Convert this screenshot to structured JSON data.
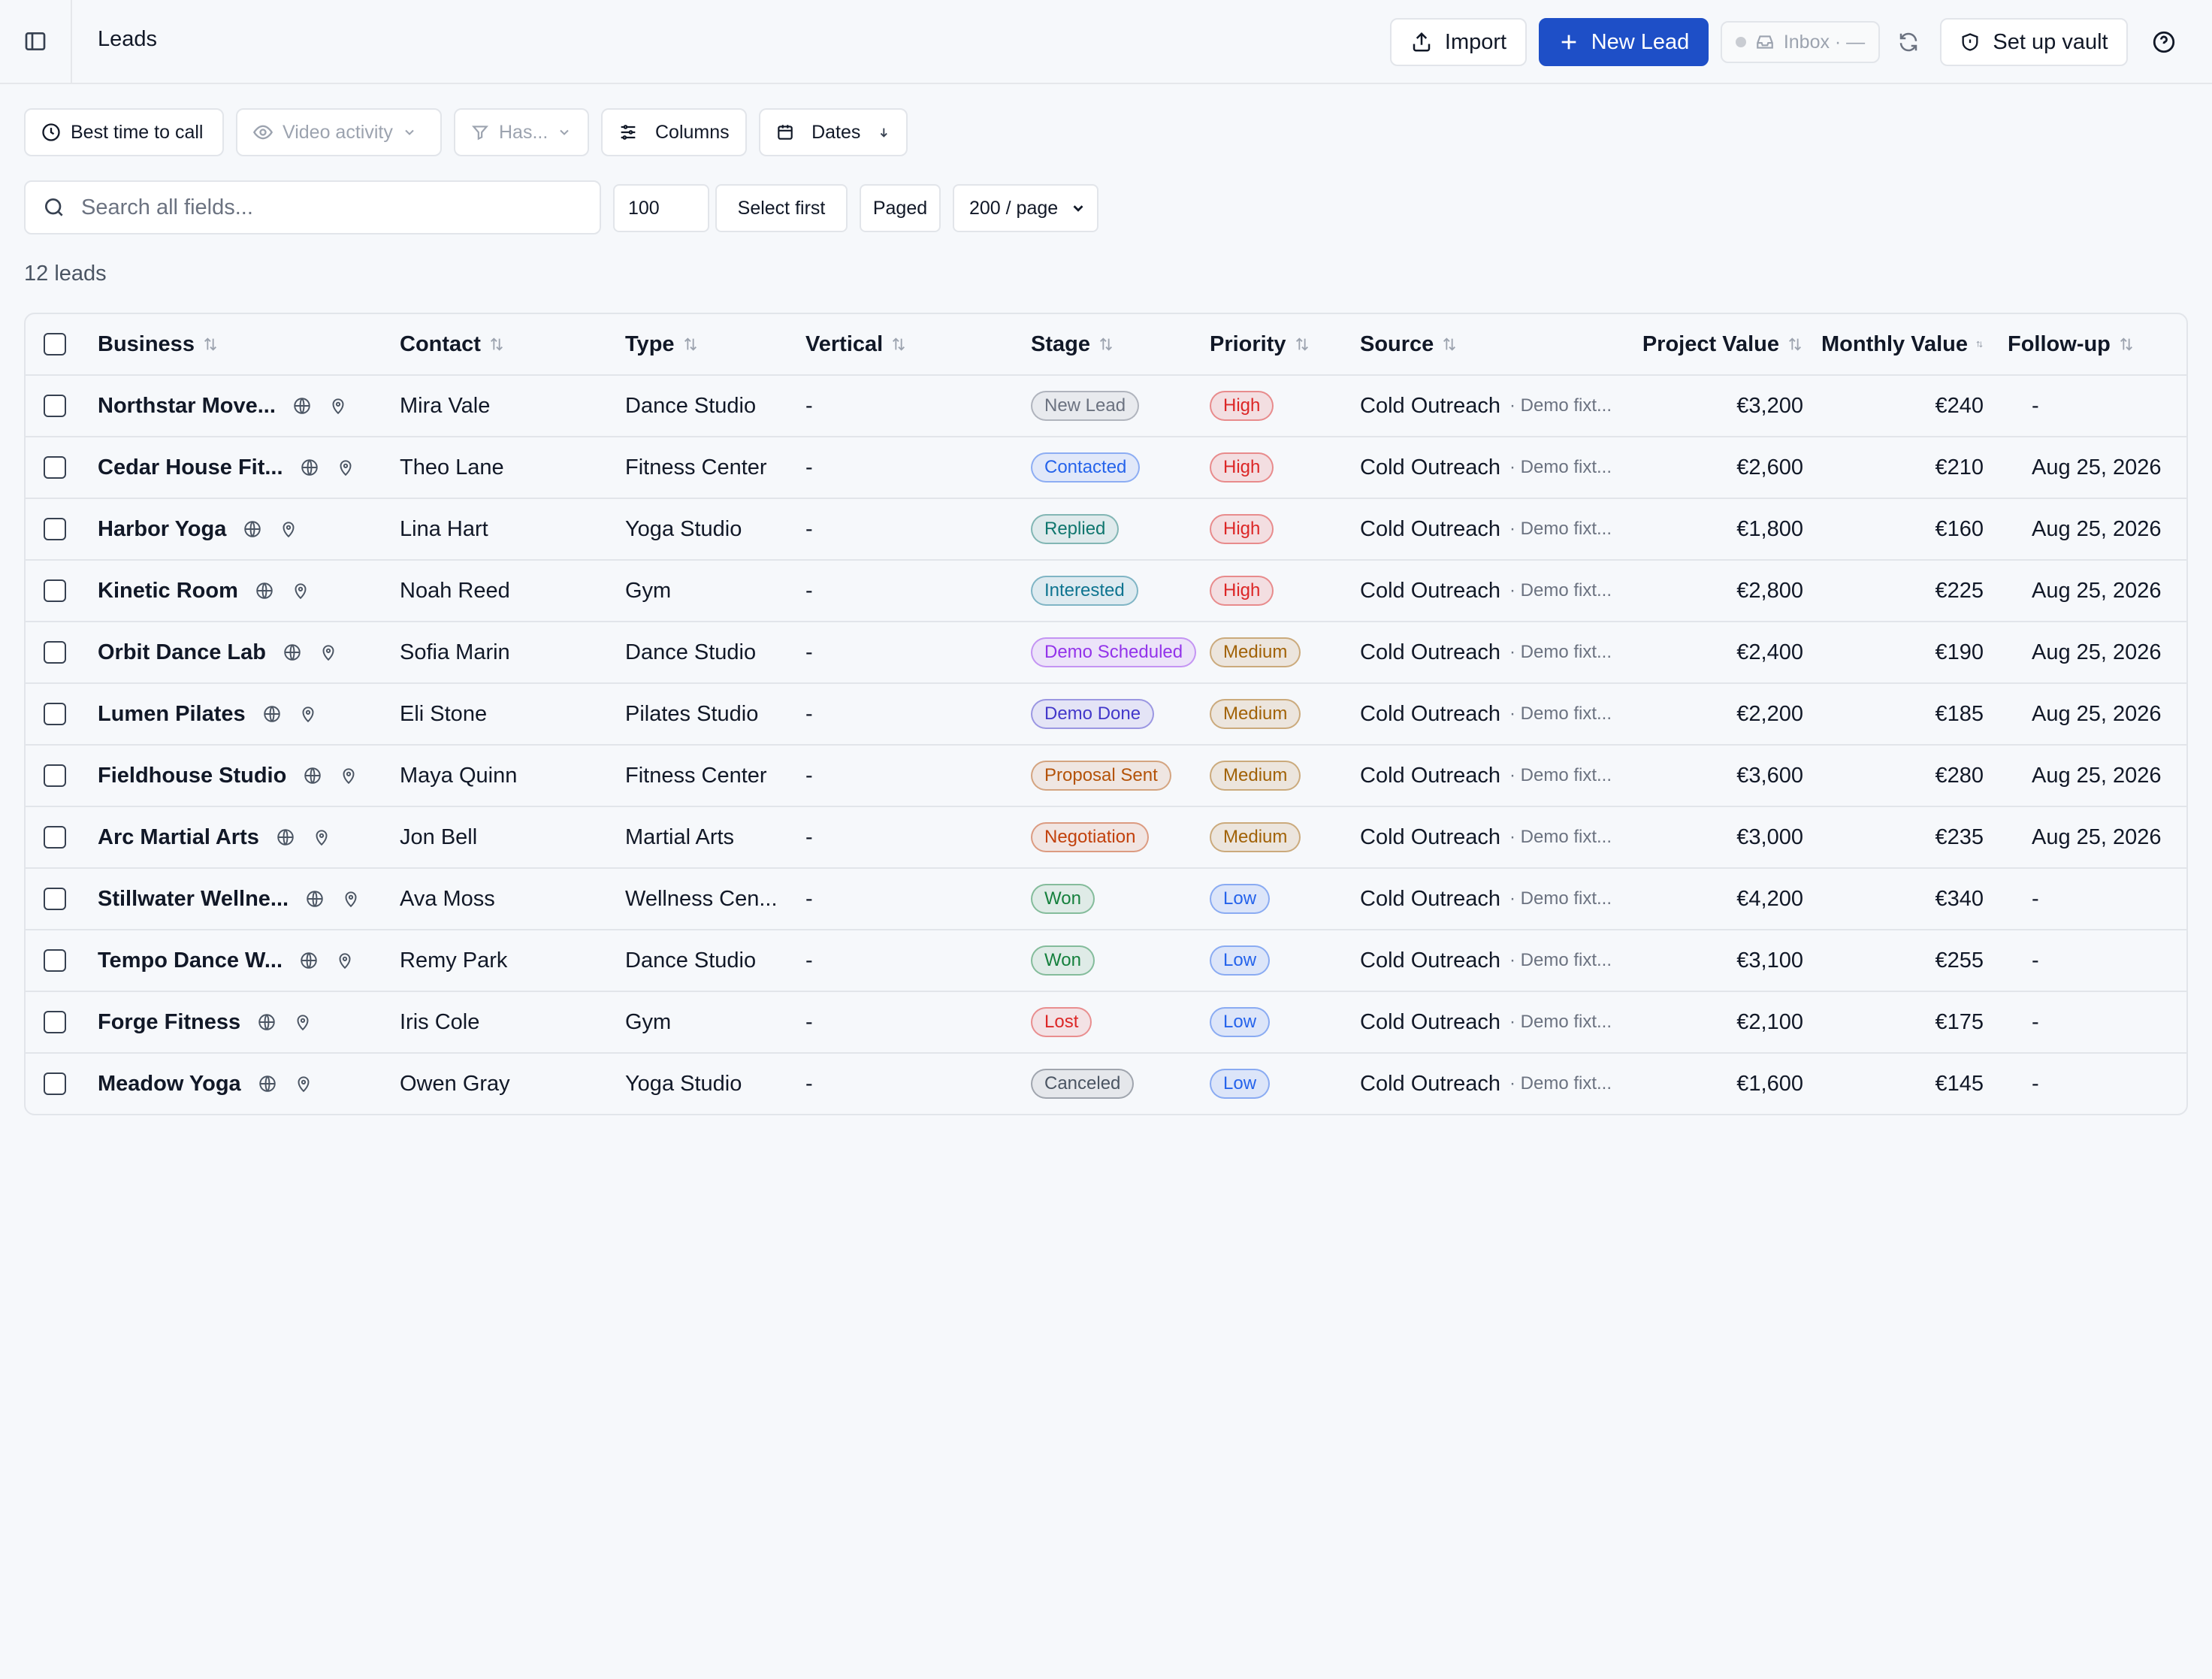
{
  "header": {
    "title": "Leads",
    "import_label": "Import",
    "new_lead_label": "New Lead",
    "inbox_label": "Inbox · —",
    "vault_label": "Set up vault"
  },
  "filters": {
    "best_time": "Best time to call",
    "video_activity": "Video activity",
    "has": "Has...",
    "columns": "Columns",
    "dates": "Dates"
  },
  "search": {
    "placeholder": "Search all fields...",
    "count_value": "100",
    "select_first": "Select first",
    "paged": "Paged",
    "per_page": "200 / page"
  },
  "lead_count": "12 leads",
  "columns": [
    "Business",
    "Contact",
    "Type",
    "Vertical",
    "Stage",
    "Priority",
    "Source",
    "Project Value",
    "Monthly Value",
    "Follow-up"
  ],
  "source_note": "· Demo fixt...",
  "colors": {
    "accent": "#1e4fc7",
    "stage": {
      "New Lead": "#6b7280",
      "Contacted": "#2563eb",
      "Replied": "#0f766e",
      "Interested": "#0e7490",
      "Demo Scheduled": "#9333ea",
      "Demo Done": "#4338ca",
      "Proposal Sent": "#b45309",
      "Negotiation": "#c2410c",
      "Won": "#15803d",
      "Lost": "#dc2626",
      "Canceled": "#4b5563"
    },
    "priority": {
      "High": "#dc2626",
      "Medium": "#a16207",
      "Low": "#2563eb"
    }
  },
  "rows": [
    {
      "business": "Northstar Move...",
      "contact": "Mira Vale",
      "type": "Dance Studio",
      "vertical": "-",
      "stage": "New Lead",
      "priority": "High",
      "source": "Cold Outreach",
      "project_value": "€3,200",
      "monthly_value": "€240",
      "follow_up": "-"
    },
    {
      "business": "Cedar House Fit...",
      "contact": "Theo Lane",
      "type": "Fitness Center",
      "vertical": "-",
      "stage": "Contacted",
      "priority": "High",
      "source": "Cold Outreach",
      "project_value": "€2,600",
      "monthly_value": "€210",
      "follow_up": "Aug 25, 2026"
    },
    {
      "business": "Harbor Yoga",
      "contact": "Lina Hart",
      "type": "Yoga Studio",
      "vertical": "-",
      "stage": "Replied",
      "priority": "High",
      "source": "Cold Outreach",
      "project_value": "€1,800",
      "monthly_value": "€160",
      "follow_up": "Aug 25, 2026"
    },
    {
      "business": "Kinetic Room",
      "contact": "Noah Reed",
      "type": "Gym",
      "vertical": "-",
      "stage": "Interested",
      "priority": "High",
      "source": "Cold Outreach",
      "project_value": "€2,800",
      "monthly_value": "€225",
      "follow_up": "Aug 25, 2026"
    },
    {
      "business": "Orbit Dance Lab",
      "contact": "Sofia Marin",
      "type": "Dance Studio",
      "vertical": "-",
      "stage": "Demo Scheduled",
      "priority": "Medium",
      "source": "Cold Outreach",
      "project_value": "€2,400",
      "monthly_value": "€190",
      "follow_up": "Aug 25, 2026"
    },
    {
      "business": "Lumen Pilates",
      "contact": "Eli Stone",
      "type": "Pilates Studio",
      "vertical": "-",
      "stage": "Demo Done",
      "priority": "Medium",
      "source": "Cold Outreach",
      "project_value": "€2,200",
      "monthly_value": "€185",
      "follow_up": "Aug 25, 2026"
    },
    {
      "business": "Fieldhouse Studio",
      "contact": "Maya Quinn",
      "type": "Fitness Center",
      "vertical": "-",
      "stage": "Proposal Sent",
      "priority": "Medium",
      "source": "Cold Outreach",
      "project_value": "€3,600",
      "monthly_value": "€280",
      "follow_up": "Aug 25, 2026"
    },
    {
      "business": "Arc Martial Arts",
      "contact": "Jon Bell",
      "type": "Martial Arts",
      "vertical": "-",
      "stage": "Negotiation",
      "priority": "Medium",
      "source": "Cold Outreach",
      "project_value": "€3,000",
      "monthly_value": "€235",
      "follow_up": "Aug 25, 2026"
    },
    {
      "business": "Stillwater Wellne...",
      "contact": "Ava Moss",
      "type": "Wellness Cen...",
      "vertical": "-",
      "stage": "Won",
      "priority": "Low",
      "source": "Cold Outreach",
      "project_value": "€4,200",
      "monthly_value": "€340",
      "follow_up": "-"
    },
    {
      "business": "Tempo Dance W...",
      "contact": "Remy Park",
      "type": "Dance Studio",
      "vertical": "-",
      "stage": "Won",
      "priority": "Low",
      "source": "Cold Outreach",
      "project_value": "€3,100",
      "monthly_value": "€255",
      "follow_up": "-"
    },
    {
      "business": "Forge Fitness",
      "contact": "Iris Cole",
      "type": "Gym",
      "vertical": "-",
      "stage": "Lost",
      "priority": "Low",
      "source": "Cold Outreach",
      "project_value": "€2,100",
      "monthly_value": "€175",
      "follow_up": "-"
    },
    {
      "business": "Meadow Yoga",
      "contact": "Owen Gray",
      "type": "Yoga Studio",
      "vertical": "-",
      "stage": "Canceled",
      "priority": "Low",
      "source": "Cold Outreach",
      "project_value": "€1,600",
      "monthly_value": "€145",
      "follow_up": "-"
    }
  ]
}
